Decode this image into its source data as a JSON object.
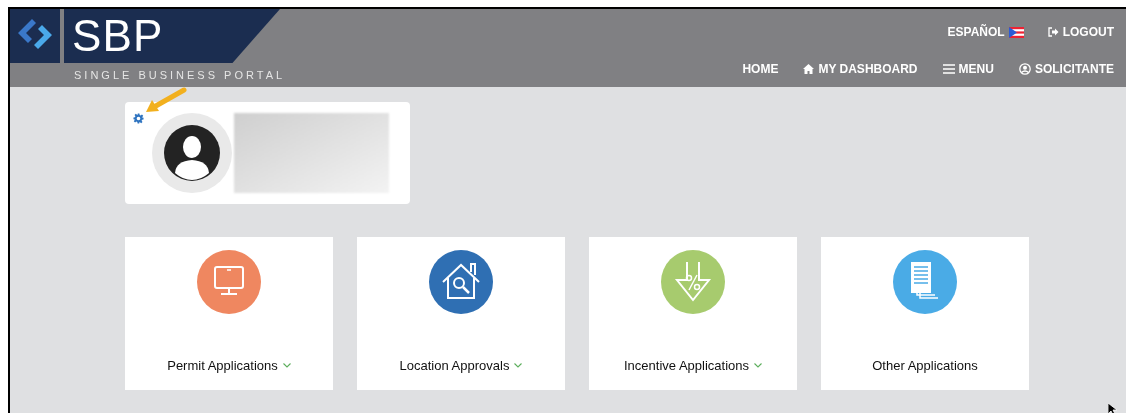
{
  "logo": {
    "text": "SBP",
    "tagline": "SINGLE BUSINESS PORTAL"
  },
  "top_links": [
    {
      "kind": "language",
      "label": "ESPAÑOL"
    },
    {
      "kind": "logout",
      "label": "LOGOUT"
    }
  ],
  "nav": [
    {
      "kind": "plain",
      "label": "HOME"
    },
    {
      "kind": "home",
      "label": "MY DASHBOARD"
    },
    {
      "kind": "menu",
      "label": "MENU"
    },
    {
      "kind": "user",
      "label": "SOLICITANTE"
    }
  ],
  "cards": [
    {
      "kind": "monitor",
      "label": "Permit Applications",
      "dropdown": true,
      "color": "#ef8760"
    },
    {
      "kind": "house",
      "label": "Location Approvals",
      "dropdown": true,
      "color": "#2f6fb3"
    },
    {
      "kind": "discount",
      "label": "Incentive Applications",
      "dropdown": true,
      "color": "#a7cb6e"
    },
    {
      "kind": "documents",
      "label": "Other Applications",
      "dropdown": false,
      "color": "#4aabe6"
    }
  ]
}
